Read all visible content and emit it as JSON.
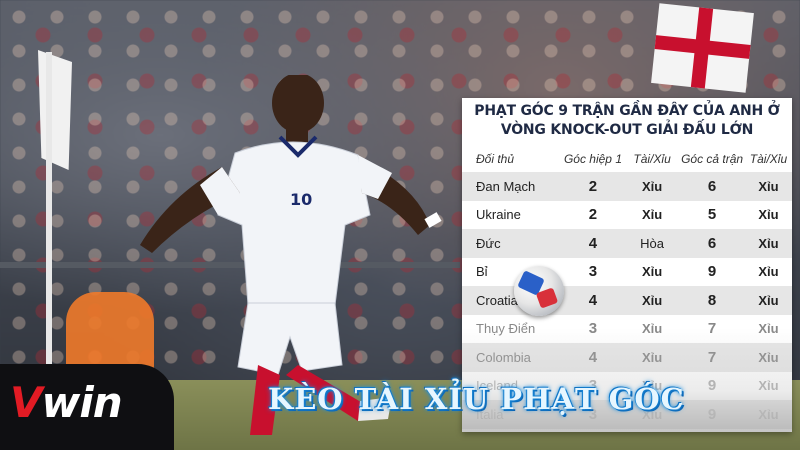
{
  "panel": {
    "title_line1": "PHẠT GÓC 9 TRẬN GẦN ĐÂY CỦA ANH Ở",
    "title_line2": "VÒNG KNOCK-OUT GIẢI ĐẤU LỚN",
    "headers": [
      "Đối thủ",
      "Góc hiệp 1",
      "Tài/Xỉu",
      "Góc cả trận",
      "Tài/Xỉu"
    ],
    "rows": [
      {
        "team": "Đan Mạch",
        "h1": "2",
        "ou1": "Xỉu",
        "ft": "6",
        "ou2": "Xỉu"
      },
      {
        "team": "Ukraine",
        "h1": "2",
        "ou1": "Xỉu",
        "ft": "5",
        "ou2": "Xỉu"
      },
      {
        "team": "Đức",
        "h1": "4",
        "ou1": "Hòa",
        "ft": "6",
        "ou2": "Xỉu"
      },
      {
        "team": "Bỉ",
        "h1": "3",
        "ou1": "Xỉu",
        "ft": "9",
        "ou2": "Xỉu"
      },
      {
        "team": "Croatia",
        "h1": "4",
        "ou1": "Xỉu",
        "ft": "8",
        "ou2": "Xỉu"
      },
      {
        "team": "Thụy Điển",
        "h1": "3",
        "ou1": "Xỉu",
        "ft": "7",
        "ou2": "Xỉu"
      },
      {
        "team": "Colombia",
        "h1": "4",
        "ou1": "Xỉu",
        "ft": "7",
        "ou2": "Xỉu"
      },
      {
        "team": "Iceland",
        "h1": "3",
        "ou1": "Xỉu",
        "ft": "9",
        "ou2": "Xỉu"
      },
      {
        "team": "Italia",
        "h1": "3",
        "ou1": "Xỉu",
        "ft": "9",
        "ou2": "Xỉu"
      }
    ]
  },
  "player": {
    "shirt_number": "10"
  },
  "logo": {
    "letter": "V",
    "rest": "win"
  },
  "headline": "KÈO TÀI XỈU PHẠT GÓC",
  "colors": {
    "brand_red": "#e21b24",
    "headline_glow": "#1a8fe0",
    "england_red": "#c8102e"
  },
  "icons": [
    "corner-flag-icon",
    "england-flag-icon",
    "football-icon"
  ]
}
